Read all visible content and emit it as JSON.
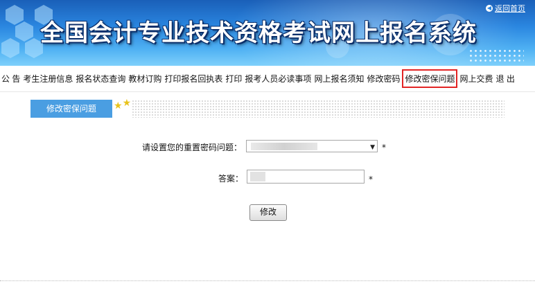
{
  "header": {
    "title": "全国会计专业技术资格考试网上报名系统",
    "return_home": "返回首页"
  },
  "nav": {
    "items": [
      {
        "label": "公 告"
      },
      {
        "label": "考生注册信息"
      },
      {
        "label": "报名状态查询"
      },
      {
        "label": "教材订购"
      },
      {
        "label": "打印报名回执表"
      },
      {
        "label": "打印"
      },
      {
        "label": "报考人员必读事项"
      },
      {
        "label": "网上报名须知"
      },
      {
        "label": "修改密码"
      },
      {
        "label": "修改密保问题",
        "active": true
      },
      {
        "label": "网上交费"
      },
      {
        "label": "退 出"
      }
    ]
  },
  "section": {
    "title": "修改密保问题"
  },
  "form": {
    "question_label": "请设置您的重置密码问题：",
    "answer_label": "答案：",
    "required_mark": "*",
    "submit_label": "修改"
  },
  "colors": {
    "highlight_border": "#e22424",
    "section_tab_bg": "#4a9ee2"
  }
}
